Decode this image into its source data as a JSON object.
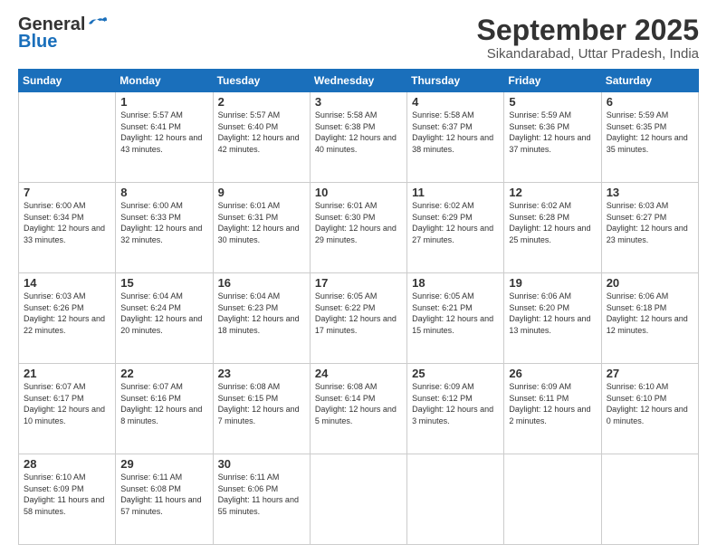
{
  "logo": {
    "general": "General",
    "blue": "Blue"
  },
  "title": "September 2025",
  "location": "Sikandarabad, Uttar Pradesh, India",
  "days_header": [
    "Sunday",
    "Monday",
    "Tuesday",
    "Wednesday",
    "Thursday",
    "Friday",
    "Saturday"
  ],
  "weeks": [
    [
      {
        "day": "",
        "sunrise": "",
        "sunset": "",
        "daylight": ""
      },
      {
        "day": "1",
        "sunrise": "Sunrise: 5:57 AM",
        "sunset": "Sunset: 6:41 PM",
        "daylight": "Daylight: 12 hours and 43 minutes."
      },
      {
        "day": "2",
        "sunrise": "Sunrise: 5:57 AM",
        "sunset": "Sunset: 6:40 PM",
        "daylight": "Daylight: 12 hours and 42 minutes."
      },
      {
        "day": "3",
        "sunrise": "Sunrise: 5:58 AM",
        "sunset": "Sunset: 6:38 PM",
        "daylight": "Daylight: 12 hours and 40 minutes."
      },
      {
        "day": "4",
        "sunrise": "Sunrise: 5:58 AM",
        "sunset": "Sunset: 6:37 PM",
        "daylight": "Daylight: 12 hours and 38 minutes."
      },
      {
        "day": "5",
        "sunrise": "Sunrise: 5:59 AM",
        "sunset": "Sunset: 6:36 PM",
        "daylight": "Daylight: 12 hours and 37 minutes."
      },
      {
        "day": "6",
        "sunrise": "Sunrise: 5:59 AM",
        "sunset": "Sunset: 6:35 PM",
        "daylight": "Daylight: 12 hours and 35 minutes."
      }
    ],
    [
      {
        "day": "7",
        "sunrise": "Sunrise: 6:00 AM",
        "sunset": "Sunset: 6:34 PM",
        "daylight": "Daylight: 12 hours and 33 minutes."
      },
      {
        "day": "8",
        "sunrise": "Sunrise: 6:00 AM",
        "sunset": "Sunset: 6:33 PM",
        "daylight": "Daylight: 12 hours and 32 minutes."
      },
      {
        "day": "9",
        "sunrise": "Sunrise: 6:01 AM",
        "sunset": "Sunset: 6:31 PM",
        "daylight": "Daylight: 12 hours and 30 minutes."
      },
      {
        "day": "10",
        "sunrise": "Sunrise: 6:01 AM",
        "sunset": "Sunset: 6:30 PM",
        "daylight": "Daylight: 12 hours and 29 minutes."
      },
      {
        "day": "11",
        "sunrise": "Sunrise: 6:02 AM",
        "sunset": "Sunset: 6:29 PM",
        "daylight": "Daylight: 12 hours and 27 minutes."
      },
      {
        "day": "12",
        "sunrise": "Sunrise: 6:02 AM",
        "sunset": "Sunset: 6:28 PM",
        "daylight": "Daylight: 12 hours and 25 minutes."
      },
      {
        "day": "13",
        "sunrise": "Sunrise: 6:03 AM",
        "sunset": "Sunset: 6:27 PM",
        "daylight": "Daylight: 12 hours and 23 minutes."
      }
    ],
    [
      {
        "day": "14",
        "sunrise": "Sunrise: 6:03 AM",
        "sunset": "Sunset: 6:26 PM",
        "daylight": "Daylight: 12 hours and 22 minutes."
      },
      {
        "day": "15",
        "sunrise": "Sunrise: 6:04 AM",
        "sunset": "Sunset: 6:24 PM",
        "daylight": "Daylight: 12 hours and 20 minutes."
      },
      {
        "day": "16",
        "sunrise": "Sunrise: 6:04 AM",
        "sunset": "Sunset: 6:23 PM",
        "daylight": "Daylight: 12 hours and 18 minutes."
      },
      {
        "day": "17",
        "sunrise": "Sunrise: 6:05 AM",
        "sunset": "Sunset: 6:22 PM",
        "daylight": "Daylight: 12 hours and 17 minutes."
      },
      {
        "day": "18",
        "sunrise": "Sunrise: 6:05 AM",
        "sunset": "Sunset: 6:21 PM",
        "daylight": "Daylight: 12 hours and 15 minutes."
      },
      {
        "day": "19",
        "sunrise": "Sunrise: 6:06 AM",
        "sunset": "Sunset: 6:20 PM",
        "daylight": "Daylight: 12 hours and 13 minutes."
      },
      {
        "day": "20",
        "sunrise": "Sunrise: 6:06 AM",
        "sunset": "Sunset: 6:18 PM",
        "daylight": "Daylight: 12 hours and 12 minutes."
      }
    ],
    [
      {
        "day": "21",
        "sunrise": "Sunrise: 6:07 AM",
        "sunset": "Sunset: 6:17 PM",
        "daylight": "Daylight: 12 hours and 10 minutes."
      },
      {
        "day": "22",
        "sunrise": "Sunrise: 6:07 AM",
        "sunset": "Sunset: 6:16 PM",
        "daylight": "Daylight: 12 hours and 8 minutes."
      },
      {
        "day": "23",
        "sunrise": "Sunrise: 6:08 AM",
        "sunset": "Sunset: 6:15 PM",
        "daylight": "Daylight: 12 hours and 7 minutes."
      },
      {
        "day": "24",
        "sunrise": "Sunrise: 6:08 AM",
        "sunset": "Sunset: 6:14 PM",
        "daylight": "Daylight: 12 hours and 5 minutes."
      },
      {
        "day": "25",
        "sunrise": "Sunrise: 6:09 AM",
        "sunset": "Sunset: 6:12 PM",
        "daylight": "Daylight: 12 hours and 3 minutes."
      },
      {
        "day": "26",
        "sunrise": "Sunrise: 6:09 AM",
        "sunset": "Sunset: 6:11 PM",
        "daylight": "Daylight: 12 hours and 2 minutes."
      },
      {
        "day": "27",
        "sunrise": "Sunrise: 6:10 AM",
        "sunset": "Sunset: 6:10 PM",
        "daylight": "Daylight: 12 hours and 0 minutes."
      }
    ],
    [
      {
        "day": "28",
        "sunrise": "Sunrise: 6:10 AM",
        "sunset": "Sunset: 6:09 PM",
        "daylight": "Daylight: 11 hours and 58 minutes."
      },
      {
        "day": "29",
        "sunrise": "Sunrise: 6:11 AM",
        "sunset": "Sunset: 6:08 PM",
        "daylight": "Daylight: 11 hours and 57 minutes."
      },
      {
        "day": "30",
        "sunrise": "Sunrise: 6:11 AM",
        "sunset": "Sunset: 6:06 PM",
        "daylight": "Daylight: 11 hours and 55 minutes."
      },
      {
        "day": "",
        "sunrise": "",
        "sunset": "",
        "daylight": ""
      },
      {
        "day": "",
        "sunrise": "",
        "sunset": "",
        "daylight": ""
      },
      {
        "day": "",
        "sunrise": "",
        "sunset": "",
        "daylight": ""
      },
      {
        "day": "",
        "sunrise": "",
        "sunset": "",
        "daylight": ""
      }
    ]
  ]
}
